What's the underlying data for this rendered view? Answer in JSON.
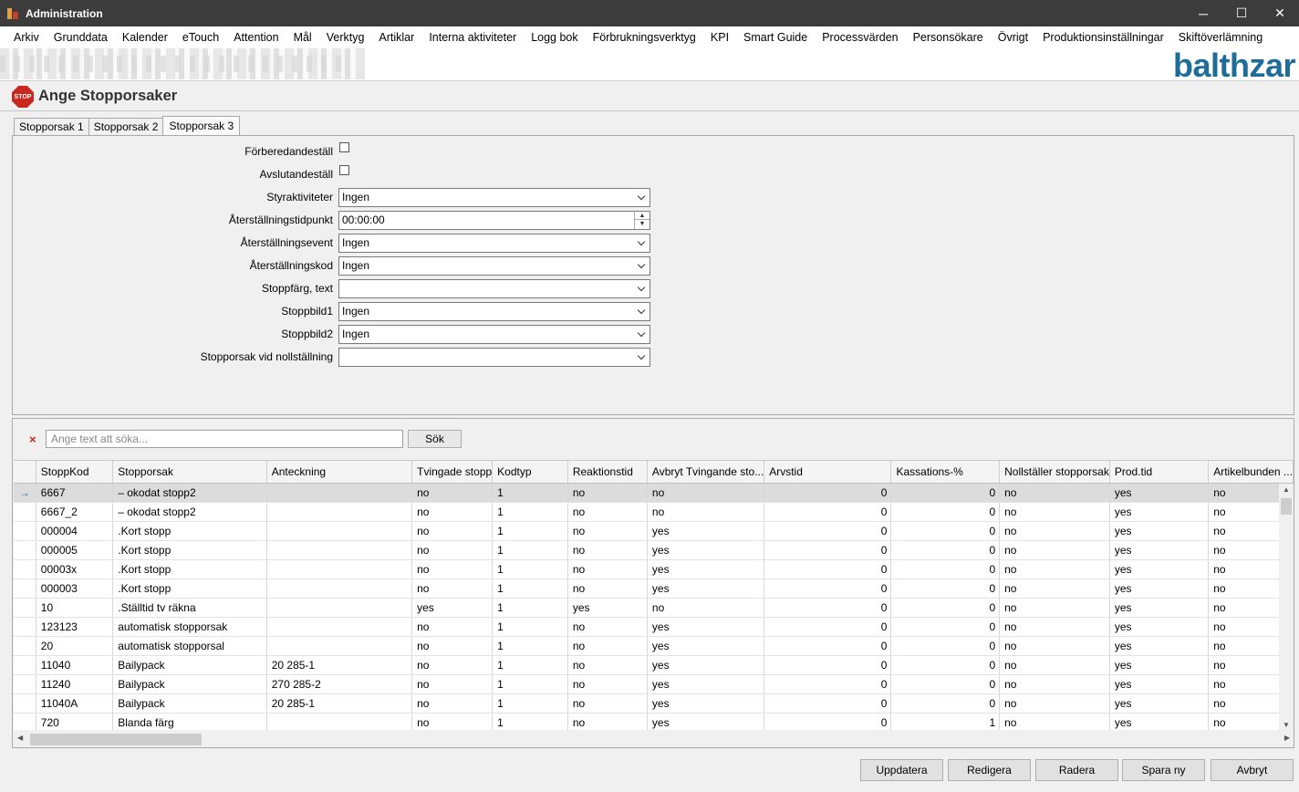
{
  "window": {
    "title": "Administration",
    "minimize_icon": "─",
    "maximize_icon": "☐",
    "close_icon": "✕"
  },
  "menu": [
    "Arkiv",
    "Grunddata",
    "Kalender",
    "eTouch",
    "Attention",
    "Mål",
    "Verktyg",
    "Artiklar",
    "Interna aktiviteter",
    "Logg bok",
    "Förbrukningsverktyg",
    "KPI",
    "Smart Guide",
    "Processvärden",
    "Personsökare",
    "Övrigt",
    "Produktionsinställningar",
    "Skiftöverlämning"
  ],
  "brand": {
    "logo": "balthzar",
    "color": "#1e6c9a"
  },
  "header": {
    "title": "Ange Stopporsaker",
    "icon_text": "STOP"
  },
  "tabs": [
    "Stopporsak 1",
    "Stopporsak 2",
    "Stopporsak 3"
  ],
  "form": {
    "forberedandestall": {
      "label": "Förberedandeställ",
      "checked": false
    },
    "avslutandestall": {
      "label": "Avslutandeställ",
      "checked": false
    },
    "styraktiviteter": {
      "label": "Styraktiviteter",
      "value": "Ingen"
    },
    "aterstallningstidpunkt": {
      "label": "Återställningstidpunkt",
      "value": "00:00:00"
    },
    "aterstallningsevent": {
      "label": "Återställningsevent",
      "value": "Ingen"
    },
    "aterstallningskod": {
      "label": "Återställningskod",
      "value": "Ingen"
    },
    "stoppfarg": {
      "label": "Stoppfärg, text",
      "value": ""
    },
    "stoppbild1": {
      "label": "Stoppbild1",
      "value": "Ingen"
    },
    "stoppbild2": {
      "label": "Stoppbild2",
      "value": "Ingen"
    },
    "nollstallning": {
      "label": "Stopporsak vid nollställning",
      "value": ""
    }
  },
  "search": {
    "placeholder": "Ange text att söka...",
    "button": "Sök",
    "clear_icon": "×"
  },
  "grid": {
    "columns": [
      "StoppKod",
      "Stopporsak",
      "Anteckning",
      "Tvingade stopp",
      "Kodtyp",
      "Reaktionstid",
      "Avbryt Tvingande sto...",
      "Arvstid",
      "Kassations-%",
      "Nollställer stopporsak",
      "Prod.tid",
      "Artikelbunden ..."
    ],
    "rows": [
      [
        "6667",
        "– okodat stopp2",
        "",
        "no",
        "1",
        "no",
        "no",
        "0",
        "0",
        "no",
        "yes",
        "no"
      ],
      [
        "6667_2",
        "– okodat stopp2",
        "",
        "no",
        "1",
        "no",
        "no",
        "0",
        "0",
        "no",
        "yes",
        "no"
      ],
      [
        "000004",
        ".Kort stopp",
        "",
        "no",
        "1",
        "no",
        "yes",
        "0",
        "0",
        "no",
        "yes",
        "no"
      ],
      [
        "000005",
        ".Kort stopp",
        "",
        "no",
        "1",
        "no",
        "yes",
        "0",
        "0",
        "no",
        "yes",
        "no"
      ],
      [
        "00003x",
        ".Kort stopp",
        "",
        "no",
        "1",
        "no",
        "yes",
        "0",
        "0",
        "no",
        "yes",
        "no"
      ],
      [
        "000003",
        ".Kort stopp",
        "",
        "no",
        "1",
        "no",
        "yes",
        "0",
        "0",
        "no",
        "yes",
        "no"
      ],
      [
        "10",
        ".Ställtid tv räkna",
        "",
        "yes",
        "1",
        "yes",
        "no",
        "0",
        "0",
        "no",
        "yes",
        "no"
      ],
      [
        "123123",
        "automatisk stopporsak",
        "",
        "no",
        "1",
        "no",
        "yes",
        "0",
        "0",
        "no",
        "yes",
        "no"
      ],
      [
        "20",
        "automatisk stopporsal",
        "",
        "no",
        "1",
        "no",
        "yes",
        "0",
        "0",
        "no",
        "yes",
        "no"
      ],
      [
        "11040",
        "Bailypack",
        "20 285-1",
        "no",
        "1",
        "no",
        "yes",
        "0",
        "0",
        "no",
        "yes",
        "no"
      ],
      [
        "11240",
        "Bailypack",
        "270 285-2",
        "no",
        "1",
        "no",
        "yes",
        "0",
        "0",
        "no",
        "yes",
        "no"
      ],
      [
        "11040A",
        "Bailypack",
        "20 285-1",
        "no",
        "1",
        "no",
        "yes",
        "0",
        "0",
        "no",
        "yes",
        "no"
      ],
      [
        "720",
        "Blanda färg",
        "",
        "no",
        "1",
        "no",
        "yes",
        "0",
        "1",
        "no",
        "yes",
        "no"
      ]
    ],
    "row_pointer_icon": "→"
  },
  "buttons": {
    "update": "Uppdatera",
    "edit": "Redigera",
    "delete": "Radera",
    "save_new": "Spara ny",
    "cancel": "Avbryt"
  }
}
